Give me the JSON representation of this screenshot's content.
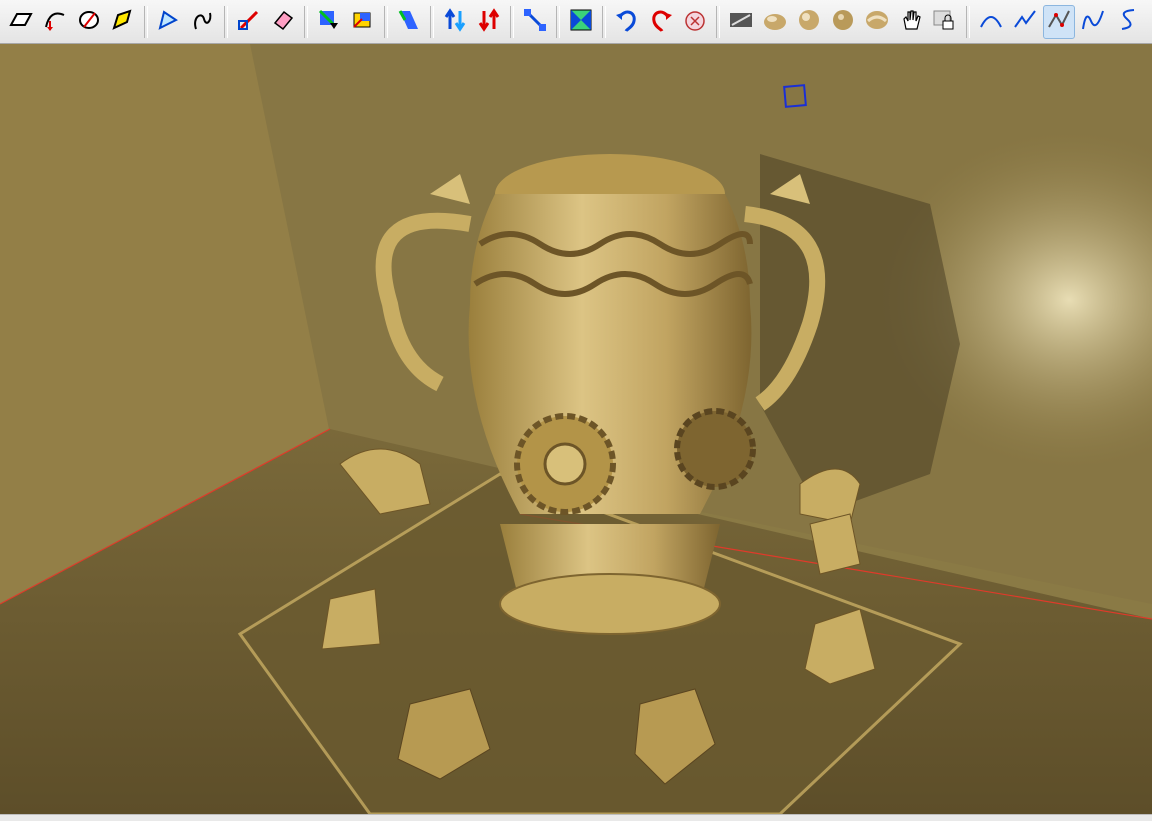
{
  "toolbar": {
    "buttons": [
      {
        "name": "rectangle-icon"
      },
      {
        "name": "arc-icon"
      },
      {
        "name": "circle-icon"
      },
      {
        "name": "polygon-icon"
      },
      {
        "name": "offset-icon"
      },
      {
        "name": "freehand-icon"
      },
      {
        "name": "move-icon"
      },
      {
        "name": "eraser-icon"
      },
      {
        "name": "push-pull-icon"
      },
      {
        "name": "paint-bucket-icon"
      },
      {
        "name": "follow-me-icon"
      },
      {
        "name": "scale-up-icon"
      },
      {
        "name": "scale-down-icon"
      },
      {
        "name": "tape-measure-icon"
      },
      {
        "name": "section-plane-icon"
      },
      {
        "name": "rotate-left-icon"
      },
      {
        "name": "rotate-right-icon"
      },
      {
        "name": "walk-icon"
      },
      {
        "name": "shadow-icon"
      },
      {
        "name": "sphere-1-icon"
      },
      {
        "name": "sphere-2-icon"
      },
      {
        "name": "sphere-3-icon"
      },
      {
        "name": "sphere-4-icon"
      },
      {
        "name": "pan-hand-icon"
      },
      {
        "name": "lock-icon"
      },
      {
        "name": "curve-arc-icon"
      },
      {
        "name": "curve-zigzag-icon"
      },
      {
        "name": "curve-split-icon"
      },
      {
        "name": "curve-n-icon"
      },
      {
        "name": "curve-s-icon"
      }
    ]
  },
  "scene": {
    "wall_color": "#8a7a45",
    "floor_color": "#6f5f33",
    "model_color": "#c7ab5e",
    "selection_box_color": "#1a2fd6",
    "axis_red": "#e03a2a"
  }
}
